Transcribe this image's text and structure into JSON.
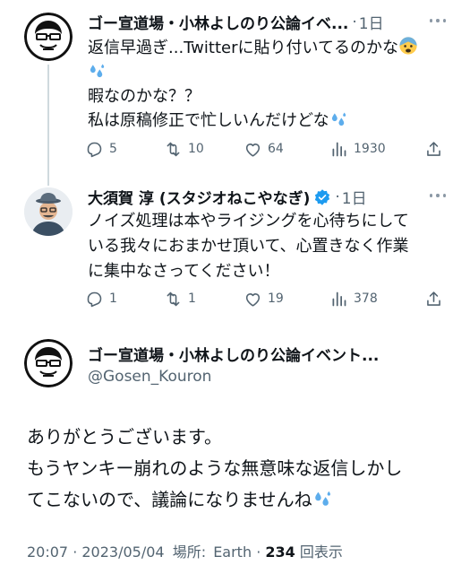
{
  "reply1": {
    "name": "ゴー宣道場・小林よしのり公論イベ...",
    "separator": "·",
    "time": "1日",
    "lines": [
      "返信早過ぎ...Twitterに貼り付いてるのかな",
      "",
      "暇なのかな？？",
      "私は原稿修正で忙しいんだけどな"
    ],
    "stats": {
      "replies": "5",
      "retweets": "10",
      "likes": "64",
      "views": "1930"
    }
  },
  "reply2": {
    "name": "大須賀 淳 (スタジオねこやなぎ)",
    "separator": "·",
    "time": "1日",
    "lines": [
      "ノイズ処理は本やライジングを心待ちにして",
      "いる我々におまかせ頂いて、心置きなく作業",
      "に集中なさってください！"
    ],
    "stats": {
      "replies": "1",
      "retweets": "1",
      "likes": "19",
      "views": "378"
    }
  },
  "main": {
    "name": "ゴー宣道場・小林よしのり公論イベント...",
    "handle": "@Gosen_Kouron",
    "lines": [
      "ありがとうございます。",
      "もうヤンキー崩れのような無意味な返信しかし",
      "てこないので、議論になりませんね"
    ],
    "time": "20:07",
    "date": "2023/05/04",
    "location_label": "場所:",
    "location": "Earth",
    "views": "234",
    "views_label": "回表示"
  },
  "colors": {
    "accent": "#1d9bf0",
    "muted": "#536471",
    "text": "#0f1419"
  },
  "icons": [
    "reply-icon",
    "retweet-icon",
    "like-icon",
    "views-icon",
    "share-icon",
    "verified-icon",
    "sweat-emoji-icon",
    "fearful-emoji-icon",
    "more-icon"
  ]
}
